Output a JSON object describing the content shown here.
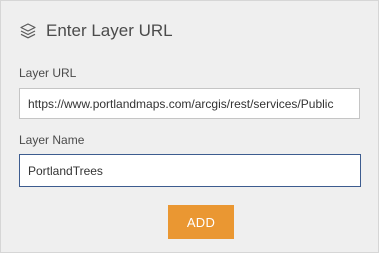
{
  "dialog": {
    "title": "Enter Layer URL",
    "title_icon": "layers-icon"
  },
  "layer_url": {
    "label": "Layer URL",
    "value": "https://www.portlandmaps.com/arcgis/rest/services/Public",
    "placeholder": ""
  },
  "layer_name": {
    "label": "Layer Name",
    "value": "PortlandTrees",
    "placeholder": ""
  },
  "actions": {
    "add_label": "ADD"
  },
  "colors": {
    "panel_bg": "#efefef",
    "accent": "#ea9732",
    "focus_border": "#3d5c8f"
  }
}
